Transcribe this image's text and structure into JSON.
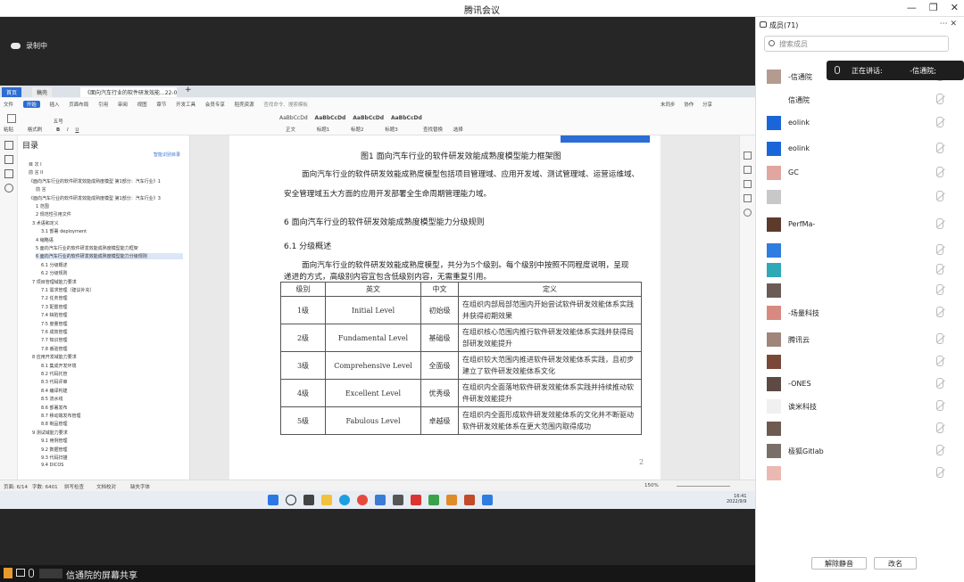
{
  "window": {
    "title": "腾讯会议"
  },
  "recording": {
    "label": "录制中"
  },
  "remote": {
    "tabs": [
      "首页",
      "稿壳",
      "《面向汽车行业的软件研发效能...22-09-05"
    ],
    "menu": [
      "文件",
      "开始",
      "插入",
      "页面布局",
      "引用",
      "审阅",
      "视图",
      "章节",
      "开发工具",
      "会员专享",
      "稻壳资源"
    ],
    "menu_search": "查找命令、搜索模板",
    "share_actions": [
      "未同步",
      "协作",
      "分享"
    ],
    "styles": [
      "AaBbCcDd",
      "AaBbCcDd",
      "AaBbCcDd",
      "AaBbCcDd"
    ],
    "style_names": [
      "正文",
      "标题1",
      "标题2",
      "标题3"
    ],
    "find_label": "查找替换",
    "select_label": "选择",
    "font_size": "五号",
    "paste_label": "粘贴",
    "format_painter_label": "格式刷",
    "outline": {
      "title": "目录",
      "smart_label": "智能识别目录",
      "items": [
        "目 次 I",
        "前 言 II",
        "《面向汽车行业的软件研发效能成熟度模型 第1部分：汽车行业》1",
        "前 言",
        "《面向汽车行业的软件研发效能成熟度模型 第1部分：汽车行业》3",
        "1 范围",
        "2 规范性引用文件",
        "3 术语和定义",
        "3.1 部署 deployment",
        "4 缩略语",
        "5 面向汽车行业的软件研发效能成熟度模型能力框架",
        "6 面向汽车行业的软件研发效能成熟度模型能力分级规则",
        "6.1 分级概述",
        "6.2 分级规则",
        "7 项目管理域能力要求",
        "7.1 需求管理（建议补充）",
        "7.2 任务管理",
        "7.3 配置管理",
        "7.4 缺陷管理",
        "7.5 度量管理",
        "7.6 成效管理",
        "7.7 知识管理",
        "7.8 番验管理",
        "8 应用开发域能力要求",
        "8.1 集成开发环境",
        "8.2 代码托管",
        "8.3 代码评审",
        "8.4 编译构建",
        "8.5 流水线",
        "8.6 部署发布",
        "8.7 移动端发布管理",
        "8.8 制品管理",
        "9 测试域能力要求",
        "9.1 用例管理",
        "9.2 数据管理",
        "9.3 代码扫描",
        "9.4 DICOS"
      ]
    },
    "doc": {
      "fig_caption": "图1 面向汽车行业的软件研发效能成熟度模型能力框架图",
      "para1_line1": "面向汽车行业的软件研发效能成熟度模型包括项目管理域、应用开发域、测试管理域、运营运维域、",
      "para1_line2": "安全管理域五大方面的应用开发部署全生命周期管理能力域。",
      "h1": "6  面向汽车行业的软件研发效能成熟度模型能力分级规则",
      "h2": "6.1  分级概述",
      "para2_line1": "面向汽车行业的软件研发效能成熟度模型，共分为5个级别。每个级别中按照不同程度说明，呈现",
      "para2_line2": "递进的方式，高级别内容宜包含低级别内容，无需重复引用。",
      "table_headers": [
        "级别",
        "英文",
        "中文",
        "定义"
      ],
      "table_rows": [
        [
          "1级",
          "Initial Level",
          "初始级",
          "在组织内部局部范围内开始尝试软件研发效能体系实践并获得初期效果"
        ],
        [
          "2级",
          "Fundamental Level",
          "基础级",
          "在组织核心范围内推行软件研发效能体系实践并获得局部研发效能提升"
        ],
        [
          "3级",
          "Comprehensive Level",
          "全面级",
          "在组织较大范围内推进软件研发效能体系实践，且初步建立了软件研发效能体系文化"
        ],
        [
          "4级",
          "Excellent Level",
          "优秀级",
          "在组织内全面落地软件研发效能体系实践并持续推动软件研发效能提升"
        ],
        [
          "5级",
          "Fabulous Level",
          "卓越级",
          "在组织内全面形成软件研发效能体系的文化并不断驱动软件研发效能体系在更大范围内取得成功"
        ]
      ],
      "page_number": "2"
    },
    "status": {
      "page": "页面: 6/14",
      "words": "字数: 6401",
      "spell": "拼写检查",
      "doc_check": "文档校对",
      "missing_font": "缺失字体",
      "zoom": "150%"
    },
    "clock": {
      "time": "16:41",
      "date": "2022/9/9"
    }
  },
  "presenter": {
    "label": "信通院的屏幕共享"
  },
  "panel": {
    "title": "成员(71)",
    "search_placeholder": "搜索成员",
    "speaking_label": "正在讲话:",
    "speaking_name": "-信通院;",
    "members": [
      {
        "name": "-信通院",
        "color": "#b39b8f"
      },
      {
        "name": "信通院",
        "color": "#ffffff"
      },
      {
        "name": "eolink",
        "color": "#1a66d8"
      },
      {
        "name": "eolink",
        "color": "#1a66d8"
      },
      {
        "name": "GC",
        "color": "#e2a6a0"
      },
      {
        "name": "",
        "color": "#c8c8c8"
      },
      {
        "name": "PerfMa-",
        "color": "#5c3b2c"
      },
      {
        "name": "",
        "color": "#2f7de0"
      },
      {
        "name": "",
        "color": "#2fa8b8"
      },
      {
        "name": "",
        "color": "#6b5b55"
      },
      {
        "name": "-场量科技",
        "color": "#d98a80"
      },
      {
        "name": "腾讯云",
        "color": "#a0857a"
      },
      {
        "name": "",
        "color": "#7a4838"
      },
      {
        "name": "-ONES",
        "color": "#5d4a44"
      },
      {
        "name": "诶米科技",
        "color": "#f0f0f0"
      },
      {
        "name": "",
        "color": "#6e5a50"
      },
      {
        "name": "极狐Gitlab",
        "color": "#7a6f68"
      },
      {
        "name": "",
        "color": "#ebb9b2"
      }
    ],
    "mute_all": "解除静音",
    "rename": "改名"
  }
}
